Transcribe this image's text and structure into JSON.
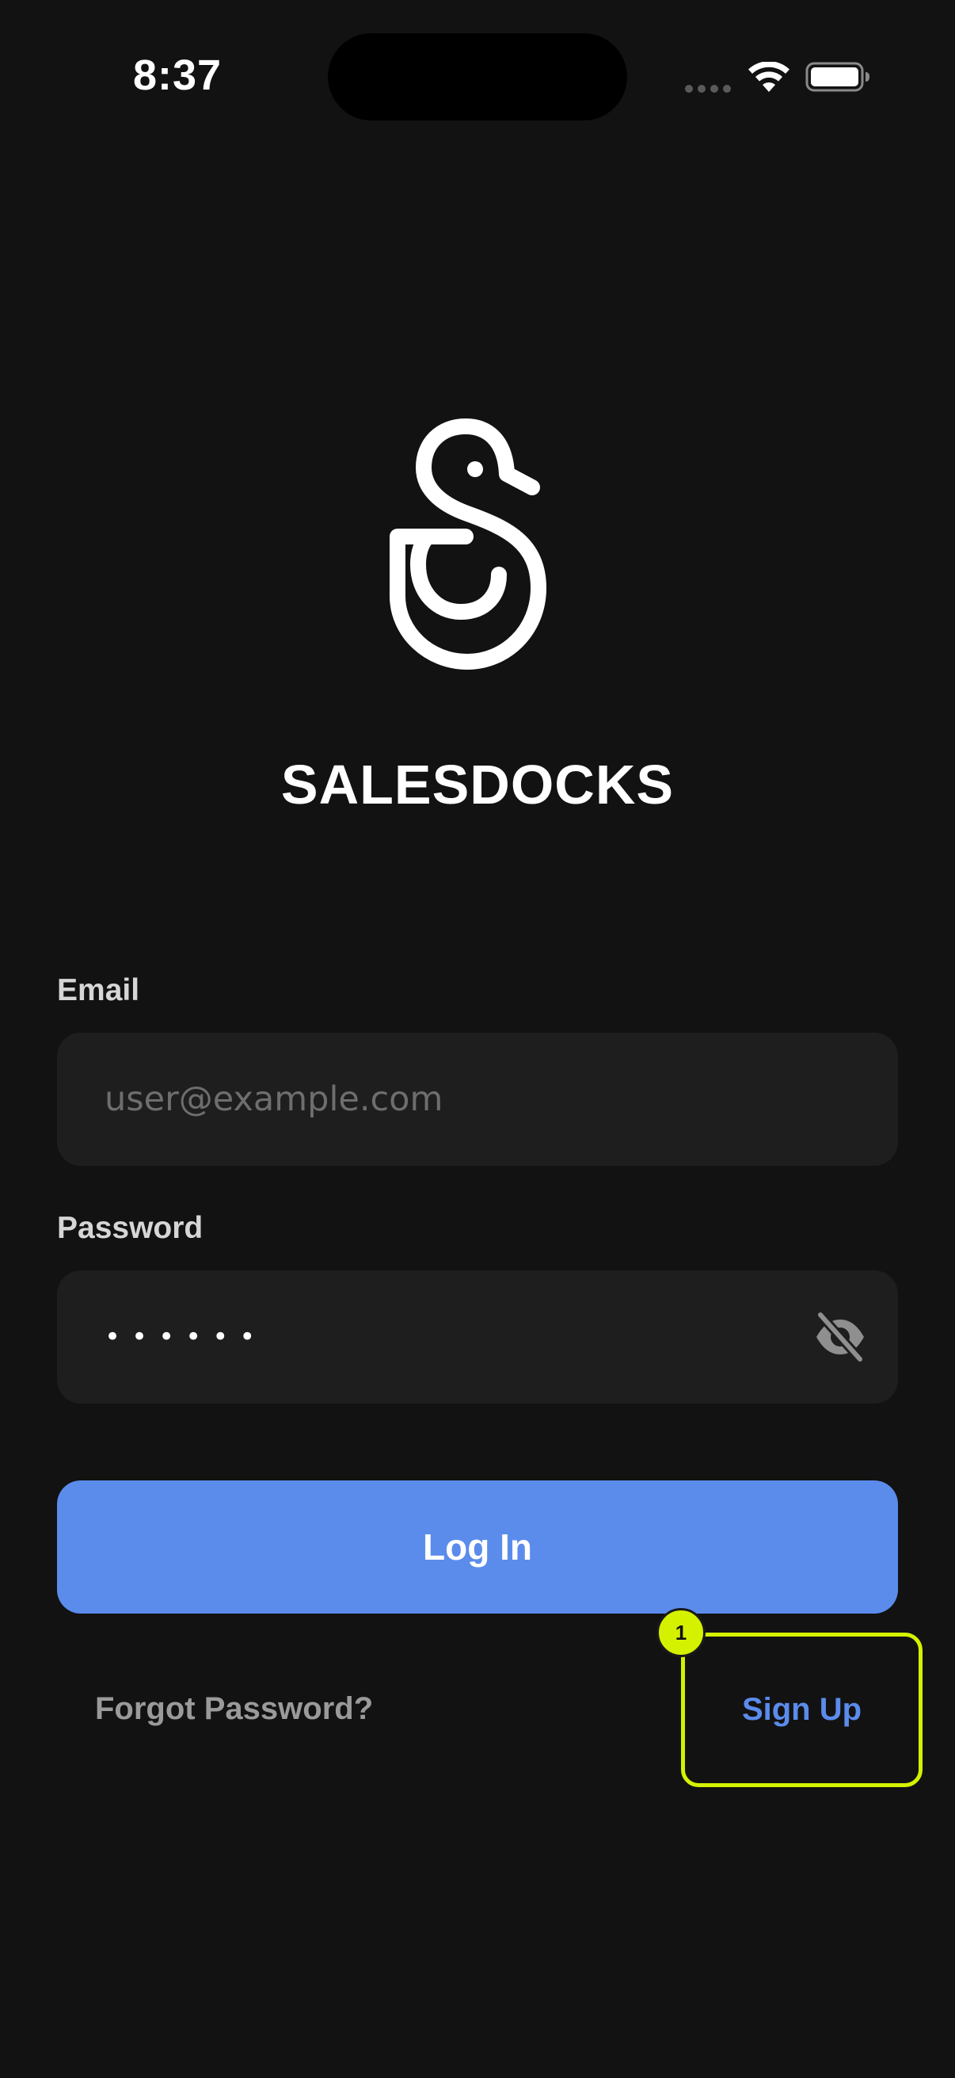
{
  "status_bar": {
    "time": "8:37"
  },
  "brand": {
    "name": "SALESDOCKS",
    "logo_icon": "salesdocks-duck-logo"
  },
  "form": {
    "email_label": "Email",
    "email_placeholder": "user@example.com",
    "email_value": "",
    "password_label": "Password",
    "password_value_masked": "••••••",
    "password_toggle_icon": "eye-slash-icon",
    "login_label": "Log In",
    "forgot_label": "Forgot Password?",
    "signup_label": "Sign Up"
  },
  "annotation": {
    "marker_number": "1"
  },
  "colors": {
    "background": "#121212",
    "field": "#1e1e1e",
    "accent": "#5b8cec",
    "highlight": "#d4f200",
    "muted_text": "#9a9a9a"
  }
}
